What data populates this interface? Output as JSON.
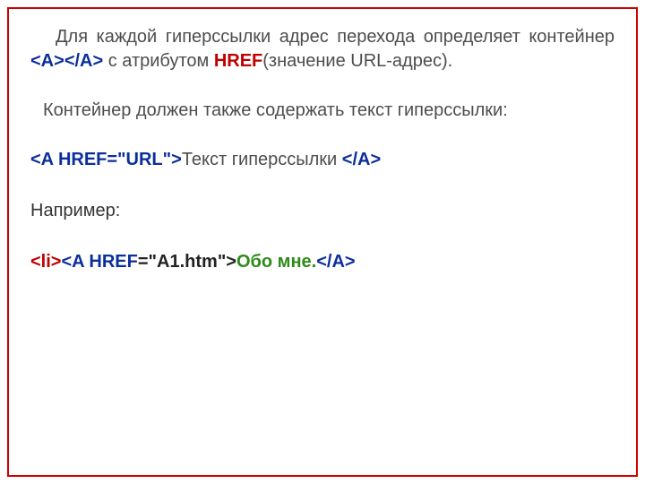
{
  "p1": {
    "t1": "Для каждой гиперссылки адрес перехода определяет контейнер ",
    "tag_open": "<A>",
    "tag_close": "</A>",
    "t2": " с атрибутом ",
    "href": "HREF",
    "t3": "(значение URL-адрес)."
  },
  "p2": {
    "text": "Контейнер должен также содержать текст гиперссылки:"
  },
  "p3": {
    "code_open": "<A HREF=\"URL\">",
    "link_text": "Текст гиперссылки   ",
    "code_close": "</A>"
  },
  "p4": {
    "text": "Например:"
  },
  "p5": {
    "li": "<li>",
    "a": "<A HREF",
    "val": "=\"A1.htm\">",
    "txt": "Обо мне.",
    "close": "</A>"
  }
}
